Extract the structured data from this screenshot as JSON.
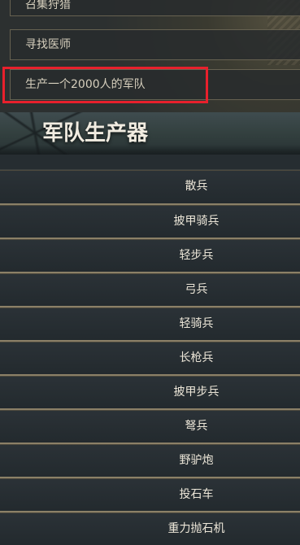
{
  "menu": {
    "items": [
      {
        "label": "召集狩猎"
      },
      {
        "label": "寻找医师"
      },
      {
        "label": "生产一个2000人的军队"
      }
    ]
  },
  "header": {
    "title": "军队生产器"
  },
  "units": [
    {
      "label": "散兵"
    },
    {
      "label": "披甲骑兵"
    },
    {
      "label": "轻步兵"
    },
    {
      "label": "弓兵"
    },
    {
      "label": "轻骑兵"
    },
    {
      "label": "长枪兵"
    },
    {
      "label": "披甲步兵"
    },
    {
      "label": "弩兵"
    },
    {
      "label": "野驴炮"
    },
    {
      "label": "投石车"
    },
    {
      "label": "重力抛石机"
    }
  ],
  "colors": {
    "highlight": "#e8202c",
    "text": "#ece6d8",
    "background": "#262d31"
  }
}
